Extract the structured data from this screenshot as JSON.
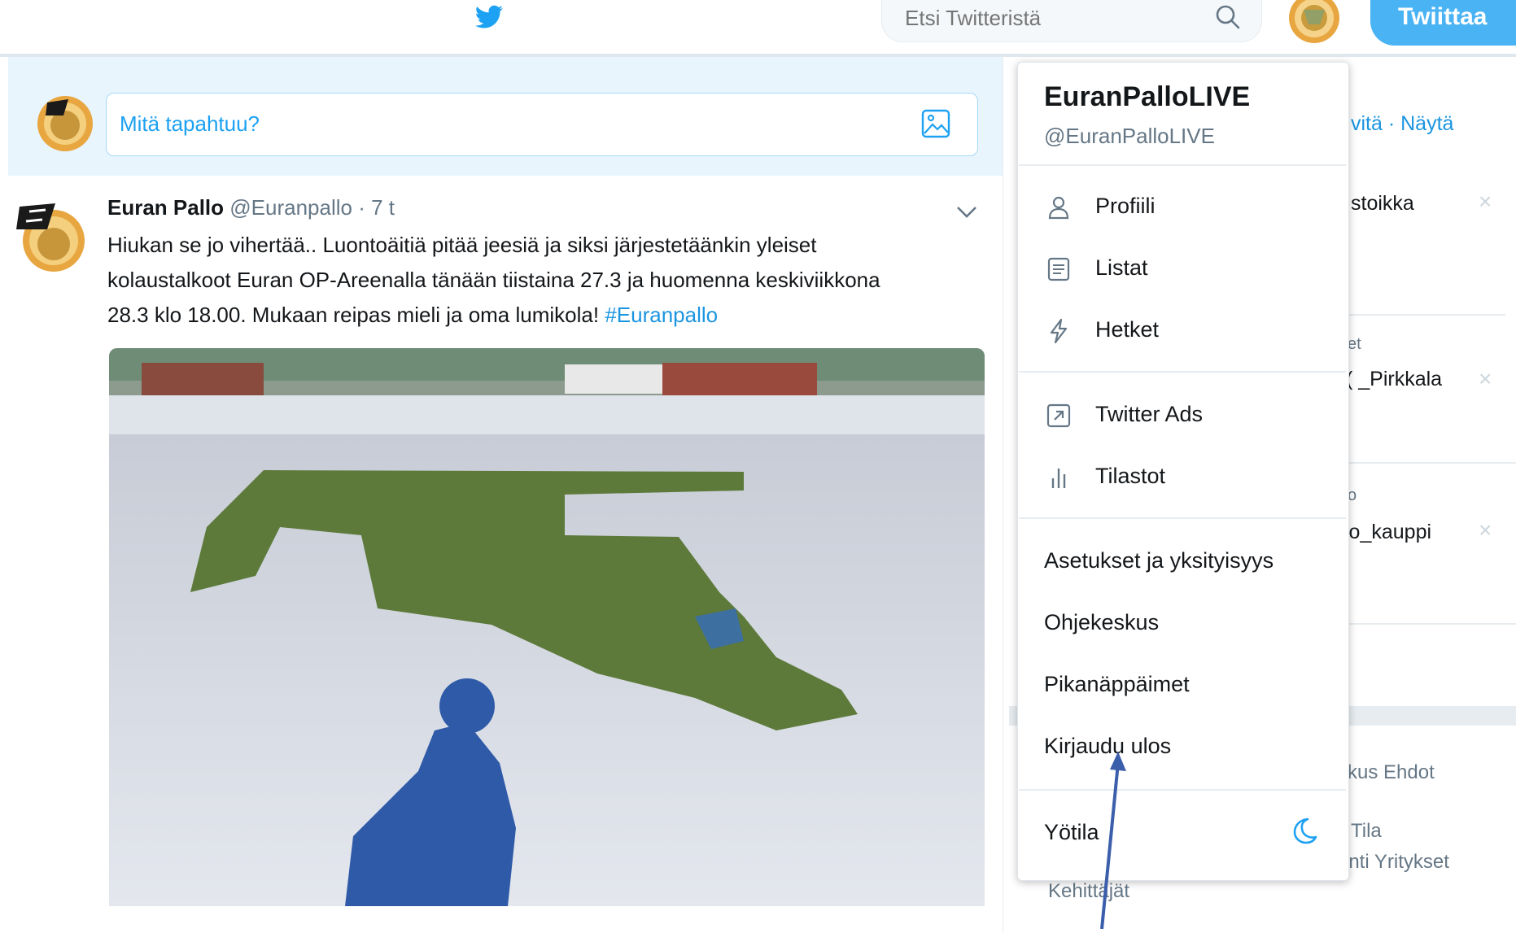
{
  "colors": {
    "accent": "#1da1f2",
    "tweet_button": "#4ab3f4",
    "composer_bg": "#e8f5fd",
    "arrow": "#3b5fab"
  },
  "header": {
    "search_placeholder": "Etsi Twitteristä",
    "tweet_button": "Twiittaa"
  },
  "composer": {
    "placeholder": "Mitä tapahtuu?"
  },
  "tweet": {
    "name": "Euran Pallo",
    "handle": "@Euranpallo",
    "time": "· 7 t",
    "lines": [
      "Hiukan se jo vihertää.. Luontoäitiä pitää jeesiä ja siksi järjestetäänkin yleiset",
      "kolaustalkoot Euran OP-Areenalla tänään tiistaina 27.3 ja huomenna keskiviikkona",
      "28.3 klo 18.00. Mukaan reipas mieli ja oma lumikola! "
    ],
    "hashtag": "#Euranpallo"
  },
  "dropdown": {
    "name": "EuranPalloLIVE",
    "handle": "@EuranPalloLIVE",
    "profile": "Profiili",
    "lists": "Listat",
    "moments": "Hetket",
    "ads": "Twitter Ads",
    "analytics": "Tilastot",
    "settings": "Asetukset ja yksityisyys",
    "help": "Ohjekeskus",
    "shortcuts": "Pikanäppäimet",
    "logout": "Kirjaudu ulos",
    "night_mode": "Yötila"
  },
  "right": {
    "refresh_show": "vitä · Näytä",
    "who1": "stoikka",
    "who2_top": "et",
    "who2": "( _Pirkkala",
    "who3_top": "o",
    "who3": "io_kauppi",
    "footer1": "kus  Ehdot",
    "footer2": "Tila",
    "footer3": "inti  Yritykset",
    "footer4": "Kehittäjät"
  }
}
